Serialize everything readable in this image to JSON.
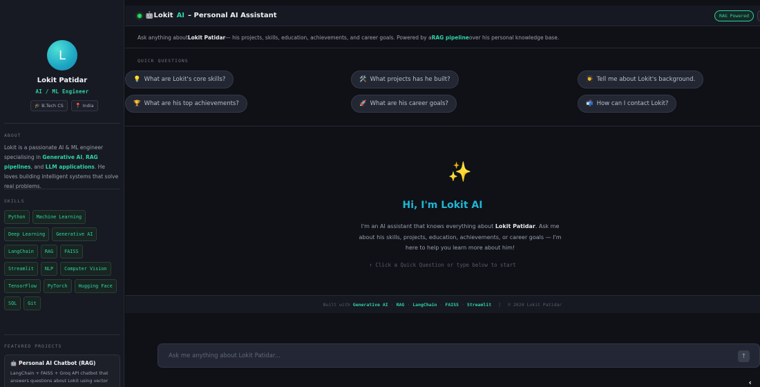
{
  "sidebar": {
    "avatar_initial": "L",
    "name": "Lokit Patidar",
    "role": "AI / ML Engineer",
    "tags": [
      {
        "icon": "graduation-icon",
        "glyph": "🎓",
        "label": "B.Tech CS"
      },
      {
        "icon": "pin-icon",
        "glyph": "📍",
        "label": "India"
      }
    ],
    "about_title": "ABOUT",
    "about": {
      "t1": "Lokit is a passionate AI & ML engineer specialising in ",
      "h1": "Generative AI",
      "t2": ", ",
      "h2": "RAG pipelines",
      "t3": ", and ",
      "h3": "LLM applications",
      "t4": ". He loves building intelligent systems that solve real problems."
    },
    "skills_title": "SKILLS",
    "skills": [
      "Python",
      "Machine Learning",
      "Deep Learning",
      "Generative AI",
      "LangChain",
      "RAG",
      "FAISS",
      "Streamlit",
      "NLP",
      "Computer Vision",
      "TensorFlow",
      "PyTorch",
      "Hugging Face",
      "SQL",
      "Git"
    ],
    "projects_title": "FEATURED PROJECTS",
    "project": {
      "title": "🤖 Personal AI Chatbot (RAG)",
      "desc": "LangChain + FAISS + Groq API chatbot that answers questions about Lokit using vector"
    }
  },
  "header": {
    "name": "Lokit",
    "ai": "AI",
    "rest": "– Personal AI Assistant",
    "badge": "RAG Powered",
    "robot_glyph": "🤖"
  },
  "subheader": {
    "t1": "Ask anything about ",
    "b1": "Lokit Patidar",
    "t2": " — his projects, skills, education, achievements, and career goals. Powered by a ",
    "h1": "RAG pipeline",
    "t3": " over his personal knowledge base."
  },
  "quick": {
    "title": "QUICK QUESTIONS",
    "buttons": [
      {
        "icon": "bulb-icon",
        "glyph": "💡",
        "label": "What are Lokit's core skills?"
      },
      {
        "icon": "tools-icon",
        "glyph": "🛠️",
        "label": "What projects has he built?"
      },
      {
        "icon": "student-icon",
        "glyph": "👨‍🎓",
        "label": "Tell me about Lokit's background."
      },
      {
        "icon": "trophy-icon",
        "glyph": "🏆",
        "label": "What are his top achievements?"
      },
      {
        "icon": "rocket-icon",
        "glyph": "🚀",
        "label": "What are his career goals?"
      },
      {
        "icon": "mailbox-icon",
        "glyph": "📬",
        "label": "How can I contact Lokit?"
      }
    ]
  },
  "hero": {
    "glyph": "✨",
    "title": "Hi, I'm Lokit AI",
    "d1": "I'm an AI assistant that knows everything about ",
    "b1": "Lokit Patidar",
    "d2": ". Ask me about his skills, projects, education, achievements, or career goals — I'm here to help you learn more about him!",
    "hint": "↑ Click a Quick Question or type below to start"
  },
  "footer": {
    "built": "Built with",
    "items": [
      "Generative AI",
      "RAG",
      "LangChain",
      "FAISS",
      "Streamlit"
    ],
    "sep": "·",
    "bar": "|",
    "copy": "© 2024 Lokit Patidar"
  },
  "chat": {
    "placeholder": "Ask me anything about Lokit Patidar...",
    "send_glyph": "↑"
  },
  "collapse_glyph": "‹"
}
